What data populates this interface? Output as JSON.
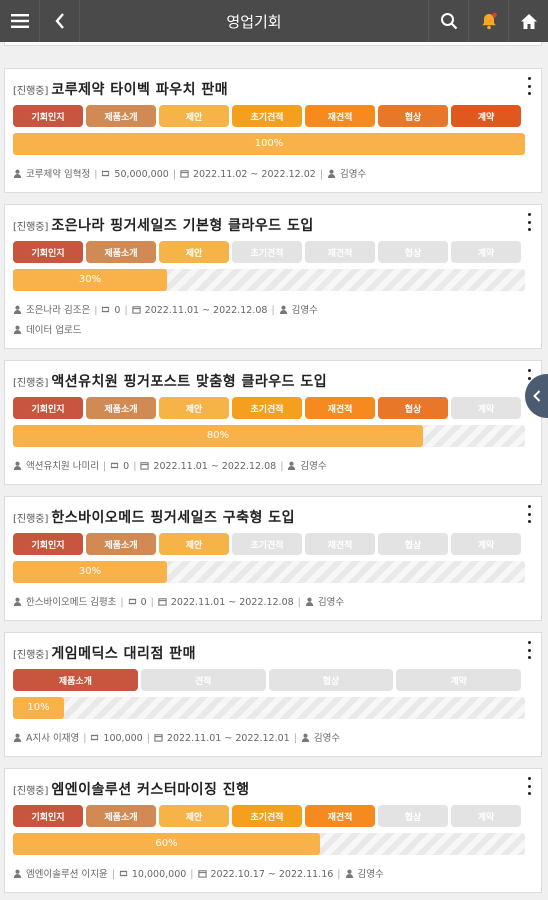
{
  "header": {
    "title": "영업기회"
  },
  "colors": {
    "topbar": "#4a4a4a",
    "bell": "#f5a623",
    "progress": "#f9b24a",
    "inactive_stage": "#e3e3e3"
  },
  "cards": [
    {
      "status": "[진행중]",
      "title": "코루제약 타이벡 파우치 판매",
      "stages": [
        {
          "label": "기회인지",
          "color": "#c8563e"
        },
        {
          "label": "제품소개",
          "color": "#d28a54"
        },
        {
          "label": "제안",
          "color": "#f6b347"
        },
        {
          "label": "초기견적",
          "color": "#f59f1e"
        },
        {
          "label": "재견적",
          "color": "#f78a1e"
        },
        {
          "label": "협상",
          "color": "#e8772a"
        },
        {
          "label": "계약",
          "color": "#e0581d"
        }
      ],
      "progress": 100,
      "progress_label": "100%",
      "company": "코루제약 임혁정",
      "amount": "50,000,000",
      "period": "2022.11.02 ~ 2022.12.02",
      "owner": "김영수",
      "extra": ""
    },
    {
      "status": "[진행중]",
      "title": "조은나라 핑거세일즈 기본형 클라우드 도입",
      "stages": [
        {
          "label": "기회인지",
          "color": "#c8563e"
        },
        {
          "label": "제품소개",
          "color": "#d28a54"
        },
        {
          "label": "제안",
          "color": "#f6b347"
        },
        {
          "label": "초기견적",
          "color": ""
        },
        {
          "label": "재견적",
          "color": ""
        },
        {
          "label": "협상",
          "color": ""
        },
        {
          "label": "계약",
          "color": ""
        }
      ],
      "progress": 30,
      "progress_label": "30%",
      "company": "조은나라 김조은",
      "amount": "0",
      "period": "2022.11.01 ~ 2022.12.08",
      "owner": "김영수",
      "extra": "데이터 업로드"
    },
    {
      "status": "[진행중]",
      "title": "액션유치원 핑거포스트 맞춤형 클라우드 도입",
      "stages": [
        {
          "label": "기회인지",
          "color": "#c8563e"
        },
        {
          "label": "제품소개",
          "color": "#d28a54"
        },
        {
          "label": "제안",
          "color": "#f6b347"
        },
        {
          "label": "초기견적",
          "color": "#f59f1e"
        },
        {
          "label": "재견적",
          "color": "#f78a1e"
        },
        {
          "label": "협상",
          "color": "#e8772a"
        },
        {
          "label": "계약",
          "color": ""
        }
      ],
      "progress": 80,
      "progress_label": "80%",
      "company": "액션유치원 나미리",
      "amount": "0",
      "period": "2022.11.01 ~ 2022.12.08",
      "owner": "김영수",
      "extra": ""
    },
    {
      "status": "[진행중]",
      "title": "한스바이오메드 핑거세일즈 구축형 도입",
      "stages": [
        {
          "label": "기회인지",
          "color": "#c8563e"
        },
        {
          "label": "제품소개",
          "color": "#d28a54"
        },
        {
          "label": "제안",
          "color": "#f6b347"
        },
        {
          "label": "초기견적",
          "color": ""
        },
        {
          "label": "재견적",
          "color": ""
        },
        {
          "label": "협상",
          "color": ""
        },
        {
          "label": "계약",
          "color": ""
        }
      ],
      "progress": 30,
      "progress_label": "30%",
      "company": "한스바이오메드 김평초",
      "amount": "0",
      "period": "2022.11.01 ~ 2022.12.08",
      "owner": "김영수",
      "extra": ""
    },
    {
      "status": "[진행중]",
      "title": "게임메딕스 대리점 판매",
      "stages": [
        {
          "label": "제품소개",
          "color": "#c8563e"
        },
        {
          "label": "견적",
          "color": ""
        },
        {
          "label": "협상",
          "color": ""
        },
        {
          "label": "계약",
          "color": ""
        }
      ],
      "progress": 10,
      "progress_label": "10%",
      "company": "A지사 이재영",
      "amount": "100,000",
      "period": "2022.11.01 ~ 2022.12.01",
      "owner": "김영수",
      "extra": ""
    },
    {
      "status": "[진행중]",
      "title": "엠엔이솔루션 커스터마이징 진행",
      "stages": [
        {
          "label": "기회인지",
          "color": "#c8563e"
        },
        {
          "label": "제품소개",
          "color": "#d28a54"
        },
        {
          "label": "제안",
          "color": "#f6b347"
        },
        {
          "label": "초기견적",
          "color": "#f59f1e"
        },
        {
          "label": "재견적",
          "color": "#f78a1e"
        },
        {
          "label": "협상",
          "color": ""
        },
        {
          "label": "계약",
          "color": ""
        }
      ],
      "progress": 60,
      "progress_label": "60%",
      "company": "엠엔이솔루션 이지윤",
      "amount": "10,000,000",
      "period": "2022.10.17 ~ 2022.11.16",
      "owner": "김영수",
      "extra": ""
    }
  ]
}
